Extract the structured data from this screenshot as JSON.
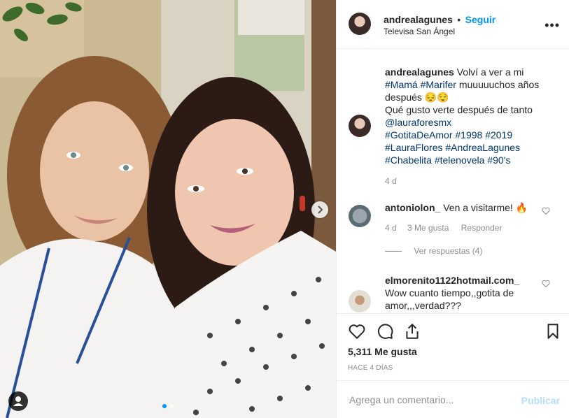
{
  "post": {
    "username": "andrealagunes",
    "separator": "•",
    "follow_label": "Seguir",
    "location": "Televisa San Ángel",
    "more_label": "•••"
  },
  "caption": {
    "username": "andrealagunes",
    "line1": "Volví a ver a mi",
    "tag_mama": "#Mamá",
    "tag_marifer": "#Marifer",
    "line2_rest": "muuuuuchos años",
    "line3": "después 😔😌",
    "line4": "Qué gusto verte después de tanto",
    "mention": "@lauraforesmx",
    "tags_line1": "#GotitaDeAmor #1998 #2019",
    "tags_line2": "#LauraFlores #AndreaLagunes",
    "tags_line3": "#Chabelita #telenovela #90's",
    "time": "4 d"
  },
  "comments": [
    {
      "username": "antoniolon_",
      "text": "Ven a visitarme! 🔥",
      "time": "4 d",
      "likes": "3 Me gusta",
      "reply_label": "Responder",
      "view_replies": "Ver respuestas (4)"
    },
    {
      "username": "elmorenito1122hotmail.com_",
      "text_line1": "Wow cuanto tiempo,,gotita de",
      "text_line2": "amor,,,verdad???"
    }
  ],
  "actions": {
    "like_icon": "heart-icon",
    "comment_icon": "comment-icon",
    "share_icon": "share-icon",
    "save_icon": "bookmark-icon"
  },
  "likes_text": "5,311 Me gusta",
  "time_ago": "HACE 4 DÍAS",
  "comment_input": {
    "placeholder": "Agrega un comentario...",
    "publish_label": "Publicar"
  }
}
